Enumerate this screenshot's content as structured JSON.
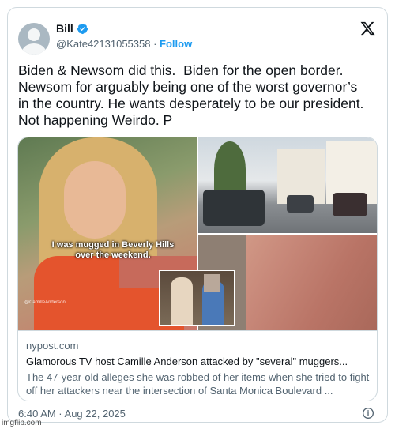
{
  "user": {
    "display_name": "Bill",
    "handle": "@Kate42131055358",
    "separator": " · ",
    "follow_label": "Follow"
  },
  "tweet": {
    "text": "Biden & Newsom did this.  Biden for the open border.\nNewsom for arguably being one of the worst governor’s\nin the country. He wants desperately to be our president.\nNot happening Weirdo. P"
  },
  "link_card": {
    "image_caption": "I was mugged in Beverly Hills over the weekend.",
    "image_watermark": "@CamilleAnderson",
    "domain": "nypost.com",
    "title": "Glamorous TV host Camille Anderson attacked by \"several\" muggers...",
    "description": "The 47-year-old alleges she was robbed of her items when she tried to fight off her attackers near the intersection of Santa Monica Boulevard ..."
  },
  "footer": {
    "timestamp": "6:40 AM · Aug 22, 2025"
  },
  "watermark": "imgflip.com",
  "icons": {
    "verified": "verified-badge-icon",
    "logo": "x-logo-icon",
    "info": "info-icon"
  },
  "colors": {
    "accent": "#1d9bf0",
    "text_primary": "#0f1419",
    "text_secondary": "#536471",
    "border": "#cfd9de"
  }
}
